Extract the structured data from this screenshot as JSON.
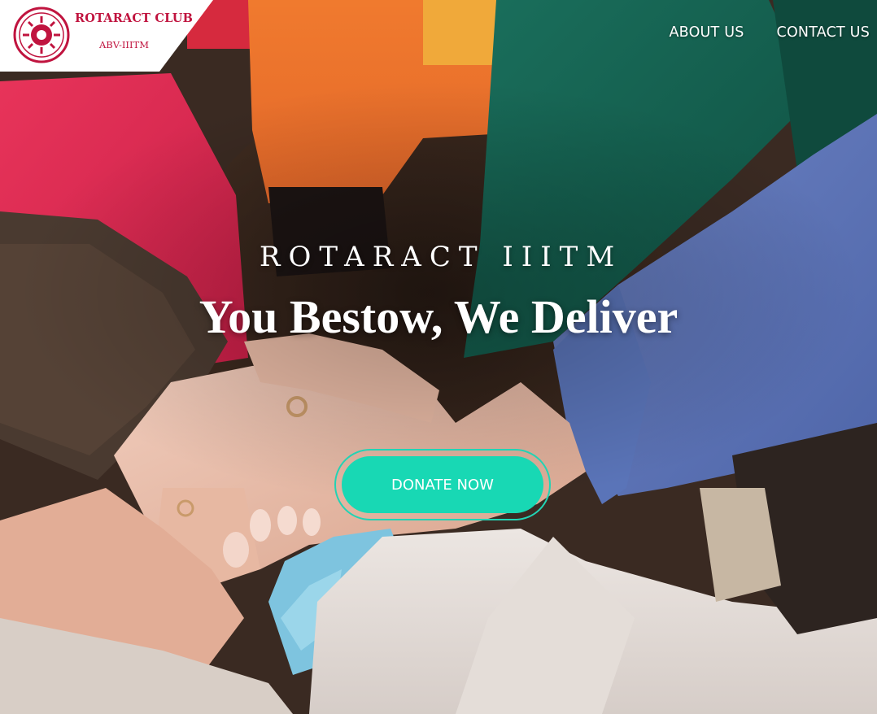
{
  "logo": {
    "name": "ROTARACT CLUB",
    "sub": "ABV-IIITM",
    "emblem_text": "ROTARACT CLUB"
  },
  "nav": {
    "items": [
      {
        "label": "ABOUT US"
      },
      {
        "label": "CONTACT US"
      }
    ]
  },
  "hero": {
    "eyebrow": "ROTARACT IIITM",
    "tagline": "You Bestow, We Deliver",
    "donate_label": "DONATE NOW",
    "image": "hands-stacked-together-photo"
  },
  "colors": {
    "brand": "#c0143f",
    "accent": "#18d8b4",
    "text": "#ffffff"
  }
}
